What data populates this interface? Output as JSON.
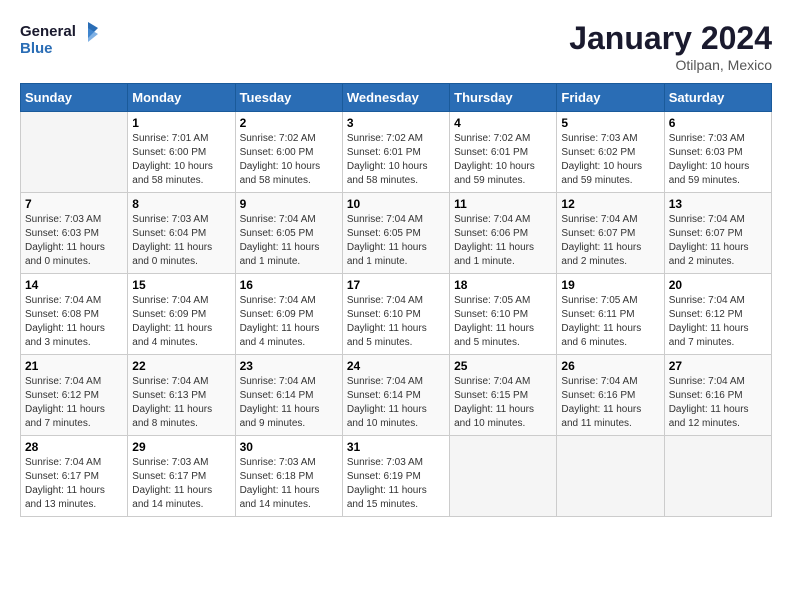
{
  "logo": {
    "line1": "General",
    "line2": "Blue"
  },
  "title": "January 2024",
  "subtitle": "Otilpan, Mexico",
  "weekdays": [
    "Sunday",
    "Monday",
    "Tuesday",
    "Wednesday",
    "Thursday",
    "Friday",
    "Saturday"
  ],
  "weeks": [
    [
      {
        "num": "",
        "empty": true
      },
      {
        "num": "1",
        "sunrise": "7:01 AM",
        "sunset": "6:00 PM",
        "daylight": "10 hours and 58 minutes."
      },
      {
        "num": "2",
        "sunrise": "7:02 AM",
        "sunset": "6:00 PM",
        "daylight": "10 hours and 58 minutes."
      },
      {
        "num": "3",
        "sunrise": "7:02 AM",
        "sunset": "6:01 PM",
        "daylight": "10 hours and 58 minutes."
      },
      {
        "num": "4",
        "sunrise": "7:02 AM",
        "sunset": "6:01 PM",
        "daylight": "10 hours and 59 minutes."
      },
      {
        "num": "5",
        "sunrise": "7:03 AM",
        "sunset": "6:02 PM",
        "daylight": "10 hours and 59 minutes."
      },
      {
        "num": "6",
        "sunrise": "7:03 AM",
        "sunset": "6:03 PM",
        "daylight": "10 hours and 59 minutes."
      }
    ],
    [
      {
        "num": "7",
        "sunrise": "7:03 AM",
        "sunset": "6:03 PM",
        "daylight": "11 hours and 0 minutes."
      },
      {
        "num": "8",
        "sunrise": "7:03 AM",
        "sunset": "6:04 PM",
        "daylight": "11 hours and 0 minutes."
      },
      {
        "num": "9",
        "sunrise": "7:04 AM",
        "sunset": "6:05 PM",
        "daylight": "11 hours and 1 minute."
      },
      {
        "num": "10",
        "sunrise": "7:04 AM",
        "sunset": "6:05 PM",
        "daylight": "11 hours and 1 minute."
      },
      {
        "num": "11",
        "sunrise": "7:04 AM",
        "sunset": "6:06 PM",
        "daylight": "11 hours and 1 minute."
      },
      {
        "num": "12",
        "sunrise": "7:04 AM",
        "sunset": "6:07 PM",
        "daylight": "11 hours and 2 minutes."
      },
      {
        "num": "13",
        "sunrise": "7:04 AM",
        "sunset": "6:07 PM",
        "daylight": "11 hours and 2 minutes."
      }
    ],
    [
      {
        "num": "14",
        "sunrise": "7:04 AM",
        "sunset": "6:08 PM",
        "daylight": "11 hours and 3 minutes."
      },
      {
        "num": "15",
        "sunrise": "7:04 AM",
        "sunset": "6:09 PM",
        "daylight": "11 hours and 4 minutes."
      },
      {
        "num": "16",
        "sunrise": "7:04 AM",
        "sunset": "6:09 PM",
        "daylight": "11 hours and 4 minutes."
      },
      {
        "num": "17",
        "sunrise": "7:04 AM",
        "sunset": "6:10 PM",
        "daylight": "11 hours and 5 minutes."
      },
      {
        "num": "18",
        "sunrise": "7:05 AM",
        "sunset": "6:10 PM",
        "daylight": "11 hours and 5 minutes."
      },
      {
        "num": "19",
        "sunrise": "7:05 AM",
        "sunset": "6:11 PM",
        "daylight": "11 hours and 6 minutes."
      },
      {
        "num": "20",
        "sunrise": "7:04 AM",
        "sunset": "6:12 PM",
        "daylight": "11 hours and 7 minutes."
      }
    ],
    [
      {
        "num": "21",
        "sunrise": "7:04 AM",
        "sunset": "6:12 PM",
        "daylight": "11 hours and 7 minutes."
      },
      {
        "num": "22",
        "sunrise": "7:04 AM",
        "sunset": "6:13 PM",
        "daylight": "11 hours and 8 minutes."
      },
      {
        "num": "23",
        "sunrise": "7:04 AM",
        "sunset": "6:14 PM",
        "daylight": "11 hours and 9 minutes."
      },
      {
        "num": "24",
        "sunrise": "7:04 AM",
        "sunset": "6:14 PM",
        "daylight": "11 hours and 10 minutes."
      },
      {
        "num": "25",
        "sunrise": "7:04 AM",
        "sunset": "6:15 PM",
        "daylight": "11 hours and 10 minutes."
      },
      {
        "num": "26",
        "sunrise": "7:04 AM",
        "sunset": "6:16 PM",
        "daylight": "11 hours and 11 minutes."
      },
      {
        "num": "27",
        "sunrise": "7:04 AM",
        "sunset": "6:16 PM",
        "daylight": "11 hours and 12 minutes."
      }
    ],
    [
      {
        "num": "28",
        "sunrise": "7:04 AM",
        "sunset": "6:17 PM",
        "daylight": "11 hours and 13 minutes."
      },
      {
        "num": "29",
        "sunrise": "7:03 AM",
        "sunset": "6:17 PM",
        "daylight": "11 hours and 14 minutes."
      },
      {
        "num": "30",
        "sunrise": "7:03 AM",
        "sunset": "6:18 PM",
        "daylight": "11 hours and 14 minutes."
      },
      {
        "num": "31",
        "sunrise": "7:03 AM",
        "sunset": "6:19 PM",
        "daylight": "11 hours and 15 minutes."
      },
      {
        "num": "",
        "empty": true
      },
      {
        "num": "",
        "empty": true
      },
      {
        "num": "",
        "empty": true
      }
    ]
  ]
}
